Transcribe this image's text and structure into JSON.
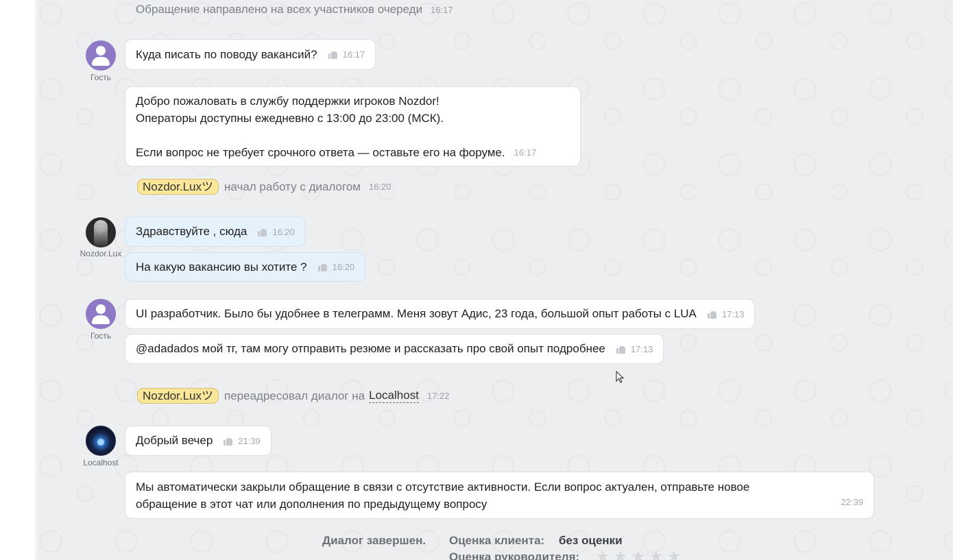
{
  "system": {
    "queue_notice": "Обращение направлено на всех участников очереди",
    "queue_time": "16:17",
    "started_agent": "Nozdor.Luxツ",
    "started_text": "начал работу с диалогом",
    "started_time": "16:20",
    "redirect_agent": "Nozdor.Luxツ",
    "redirect_text": "переадресовал диалог на",
    "redirect_target": "Localhost",
    "redirect_time": "17:22"
  },
  "participants": {
    "guest": "Гость",
    "agent1": "Nozdor.Lux",
    "agent2": "Localhost"
  },
  "messages": [
    {
      "text": "Куда писать по поводу вакансий?",
      "time": "16:17"
    },
    {
      "lines": [
        "Добро пожаловать в службу поддержки игроков Nozdor!",
        "Операторы доступны ежедневно с 13:00 до 23:00 (МСК).",
        "",
        "Если вопрос не требует срочного ответа — оставьте его на форуме."
      ],
      "time": "16:17"
    },
    {
      "text": "Здравствуйте , сюда",
      "time": "16:20"
    },
    {
      "text": "На какую вакансию вы хотите ?",
      "time": "16:20"
    },
    {
      "text": "UI разработчик. Было бы удобнее в телеграмм. Меня зовут Адис, 23 года, большой опыт работы с LUA",
      "time": "17:13"
    },
    {
      "text": "@adadados мой тг, там могу отправить резюме и рассказать про свой опыт подробнее",
      "time": "17:13"
    },
    {
      "text": "Добрый вечер",
      "time": "21:39"
    },
    {
      "lines": [
        "Мы автоматически закрыли обращение в связи с отсутствие активности. Если вопрос актуален, отправьте новое",
        "обращение в этот чат или дополнения по предыдущему вопросу"
      ],
      "time": "22:39"
    }
  ],
  "footer": {
    "status": "Диалог завершен.",
    "client_rating_label": "Оценка клиента:",
    "client_rating_value": "без оценки",
    "manager_rating_label": "Оценка руководителя:"
  },
  "colors": {
    "agent_tag_bg": "#fbe79a",
    "operator_bubble": "#e5f1fb",
    "guest_avatar": "#8e79c7"
  }
}
